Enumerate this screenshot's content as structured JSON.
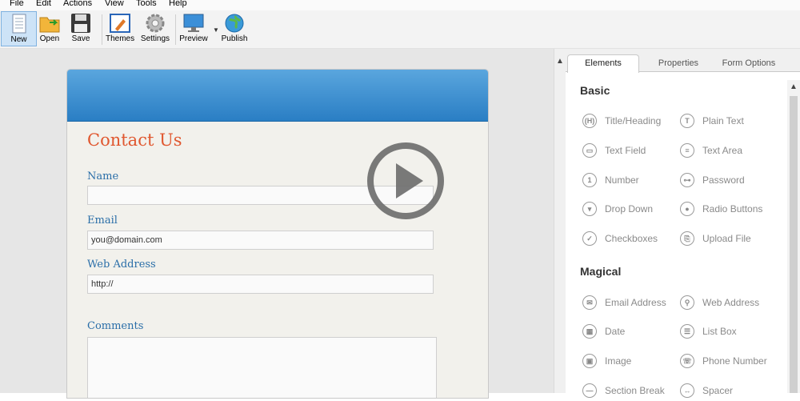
{
  "menu": [
    "File",
    "Edit",
    "Actions",
    "View",
    "Tools",
    "Help"
  ],
  "toolbar": {
    "new_label": "New",
    "open_label": "Open",
    "save_label": "Save",
    "themes_label": "Themes",
    "settings_label": "Settings",
    "preview_label": "Preview",
    "publish_label": "Publish"
  },
  "form": {
    "title": "Contact Us",
    "fields": [
      {
        "label": "Name",
        "value": ""
      },
      {
        "label": "Email",
        "value": "you@domain.com"
      },
      {
        "label": "Web Address",
        "value": "http://"
      },
      {
        "label": "Comments",
        "value": ""
      }
    ]
  },
  "panel": {
    "tabs": [
      "Elements",
      "Properties",
      "Form Options"
    ],
    "active_tab": "Elements",
    "basic_title": "Basic",
    "basic": [
      {
        "label": "Title/Heading",
        "icon": "heading-icon"
      },
      {
        "label": "Plain Text",
        "icon": "plain-text-icon"
      },
      {
        "label": "Text Field",
        "icon": "text-field-icon"
      },
      {
        "label": "Text Area",
        "icon": "text-area-icon"
      },
      {
        "label": "Number",
        "icon": "number-icon"
      },
      {
        "label": "Password",
        "icon": "password-icon"
      },
      {
        "label": "Drop Down",
        "icon": "drop-down-icon"
      },
      {
        "label": "Radio Buttons",
        "icon": "radio-buttons-icon"
      },
      {
        "label": "Checkboxes",
        "icon": "checkboxes-icon"
      },
      {
        "label": "Upload File",
        "icon": "upload-file-icon"
      }
    ],
    "magical_title": "Magical",
    "magical": [
      {
        "label": "Email Address",
        "icon": "email-icon"
      },
      {
        "label": "Web Address",
        "icon": "link-icon"
      },
      {
        "label": "Date",
        "icon": "date-icon"
      },
      {
        "label": "List Box",
        "icon": "list-box-icon"
      },
      {
        "label": "Image",
        "icon": "image-icon"
      },
      {
        "label": "Phone Number",
        "icon": "phone-icon"
      },
      {
        "label": "Section Break",
        "icon": "section-break-icon"
      },
      {
        "label": "Spacer",
        "icon": "spacer-icon"
      }
    ]
  },
  "colors": {
    "accent": "#2a7ec4",
    "title": "#e0572f",
    "label": "#2a6ea8"
  }
}
